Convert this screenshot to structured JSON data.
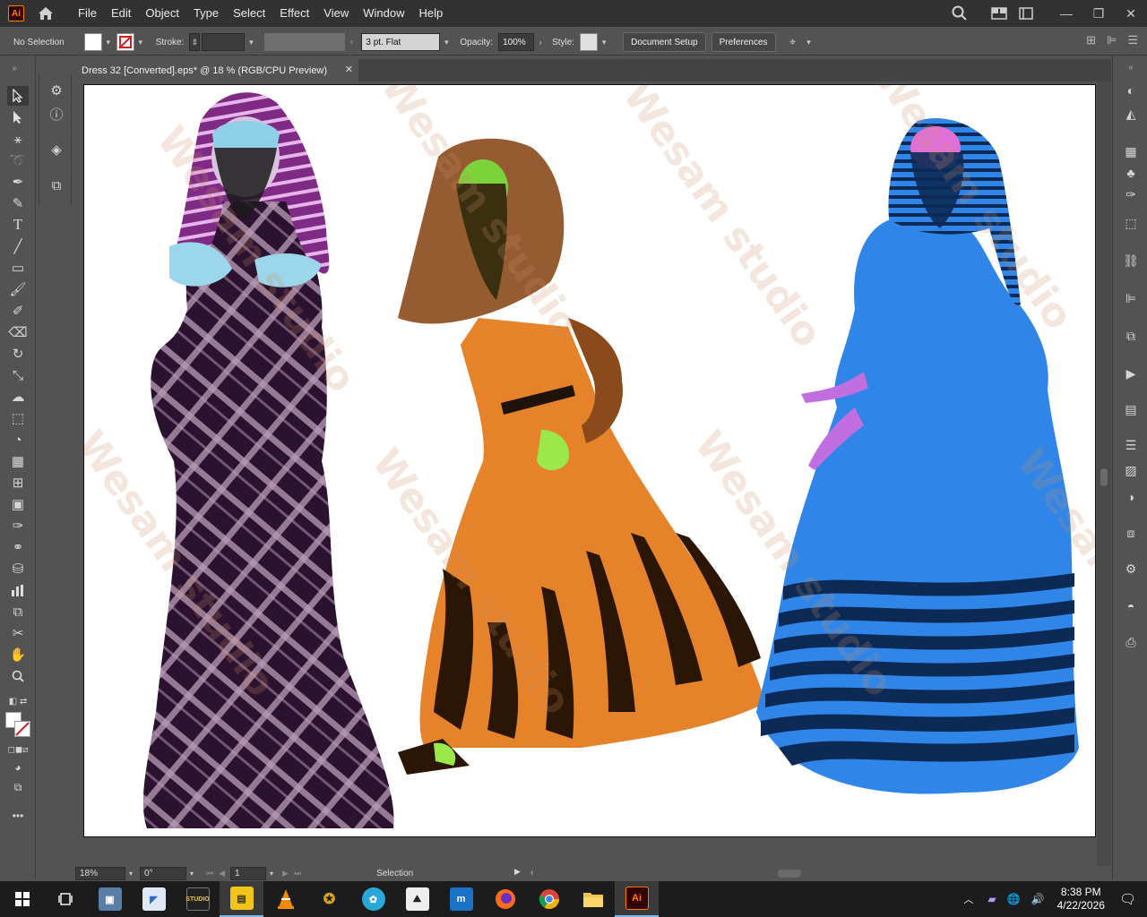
{
  "menubar": {
    "logo_text": "Ai",
    "items": [
      "File",
      "Edit",
      "Object",
      "Type",
      "Select",
      "Effect",
      "View",
      "Window",
      "Help"
    ]
  },
  "control": {
    "selection_status": "No Selection",
    "stroke_label": "Stroke:",
    "brush_value": "3 pt. Flat",
    "opacity_label": "Opacity:",
    "opacity_value": "100%",
    "style_label": "Style:",
    "document_setup": "Document Setup",
    "preferences": "Preferences"
  },
  "document": {
    "tab_title": "Dress 32 [Converted].eps* @ 18 % (RGB/CPU Preview)"
  },
  "status": {
    "zoom": "18%",
    "rotation": "0°",
    "artboard": "1",
    "current_tool": "Selection"
  },
  "artwork": {
    "watermark_text": "Wesam studio",
    "figures": [
      {
        "name": "purple-dress-figure",
        "dress_color": "#2b1230",
        "pattern_color": "#b99ab7",
        "scarf_color": "#7f2a84"
      },
      {
        "name": "orange-dress-figure",
        "dress_color": "#e6822a",
        "pattern_color": "#2b1606",
        "skin_color": "#8a4a1c"
      },
      {
        "name": "blue-dress-figure",
        "dress_color": "#2f86e8",
        "pattern_color": "#0c2a55",
        "hand_color": "#c06ee0"
      }
    ]
  },
  "taskbar": {
    "time": "8:38 PM",
    "date": "4/22/2026",
    "pinned_apps": [
      "photos",
      "paint",
      "studio",
      "photo-editor",
      "vlc",
      "game",
      "lens",
      "inkscape",
      "mail",
      "firefox",
      "chrome",
      "file-explorer",
      "illustrator"
    ]
  }
}
